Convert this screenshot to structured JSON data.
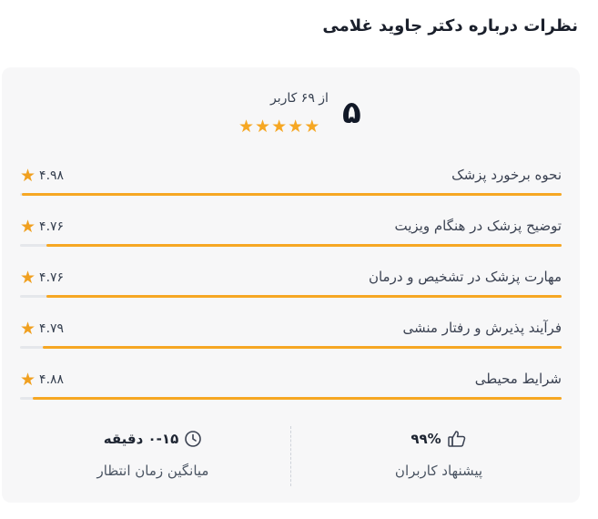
{
  "page_title": "نظرات درباره دکتر جاوید غلامی",
  "summary": {
    "score": "۵",
    "count_text": "از ۶۹ کاربر",
    "stars": 5
  },
  "metrics": [
    {
      "label": "نحوه برخورد پزشک",
      "value": "۴.۹۸",
      "fill": 0.996
    },
    {
      "label": "توضیح پزشک در هنگام ویزیت",
      "value": "۴.۷۶",
      "fill": 0.952
    },
    {
      "label": "مهارت پزشک در تشخیص و درمان",
      "value": "۴.۷۶",
      "fill": 0.952
    },
    {
      "label": "فرآیند پذیرش و رفتار منشی",
      "value": "۴.۷۹",
      "fill": 0.958
    },
    {
      "label": "شرایط محیطی",
      "value": "۴.۸۸",
      "fill": 0.976
    }
  ],
  "footer": {
    "recommend_value": "۹۹%",
    "recommend_label": "پیشنهاد کاربران",
    "wait_value": "۰-۱۵ دقیقه",
    "wait_label": "میانگین زمان انتظار"
  },
  "icons": {
    "star": "star-icon",
    "thumb": "thumbs-up-icon",
    "clock": "clock-icon"
  },
  "colors": {
    "accent": "#f6a723",
    "track": "#e5e7eb",
    "card_bg": "#f7f7f8"
  }
}
